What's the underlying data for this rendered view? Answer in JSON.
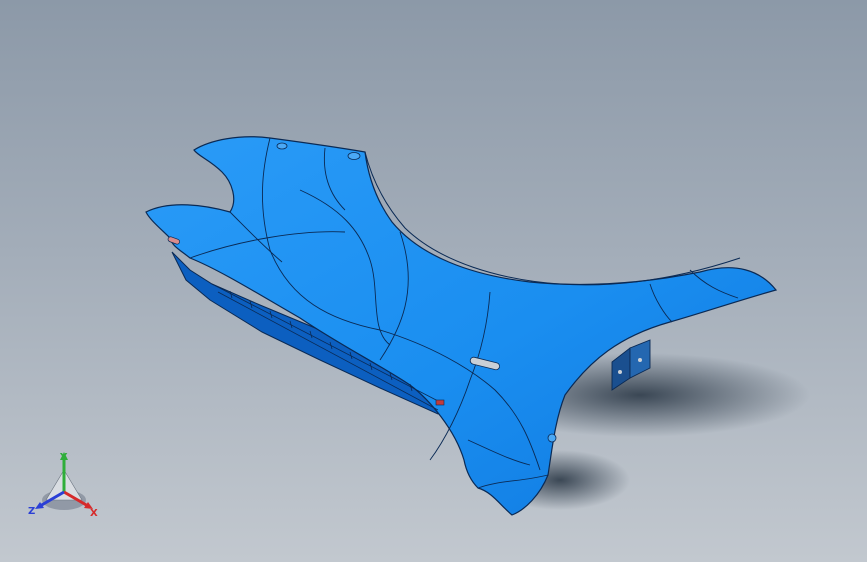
{
  "viewport": {
    "background_top": "#8c99a8",
    "background_bottom": "#c2c8cf"
  },
  "model": {
    "part_color": "#1a8ef0",
    "part_shade": "#0e6fd4",
    "edge_color": "#0a2a55",
    "shadow_color": "#2d3a48"
  },
  "triad": {
    "x_label": "X",
    "y_label": "Y",
    "z_label": "Z",
    "x_color": "#d62a2a",
    "y_color": "#2fae3a",
    "z_color": "#2a3fd6"
  }
}
